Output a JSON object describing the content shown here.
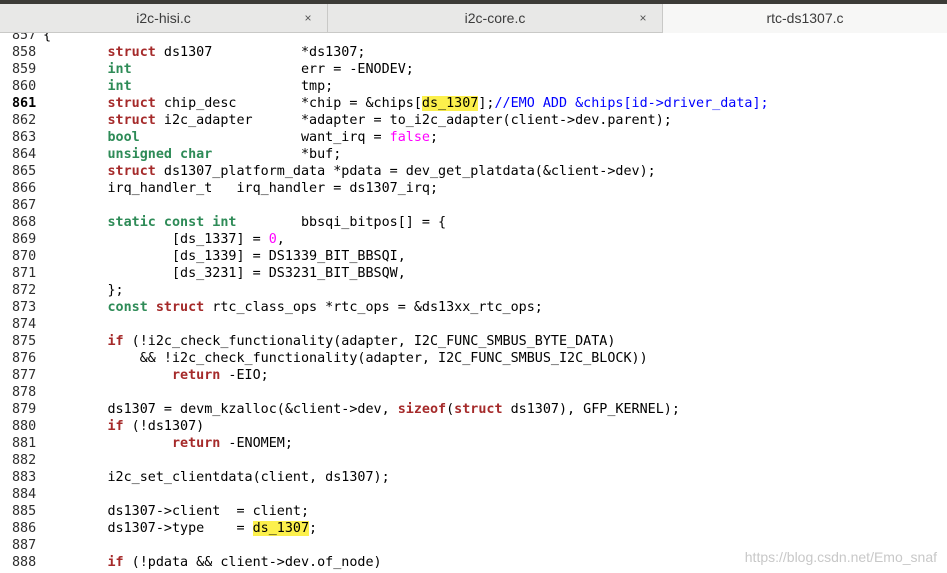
{
  "tabs": [
    {
      "label": "i2c-hisi.c",
      "close": "×"
    },
    {
      "label": "i2c-core.c",
      "close": "×"
    },
    {
      "label": "rtc-ds1307.c",
      "close": ""
    }
  ],
  "active_tab": "rtc-ds1307.c",
  "current_line": "861",
  "highlight_term": "ds_1307",
  "lines": [
    {
      "n": "857",
      "tokens": [
        [
          "t",
          "{"
        ]
      ]
    },
    {
      "n": "858",
      "tokens": [
        [
          "t",
          "        "
        ],
        [
          "kw",
          "struct"
        ],
        [
          "t",
          " ds1307           *ds1307;"
        ]
      ]
    },
    {
      "n": "859",
      "tokens": [
        [
          "t",
          "        "
        ],
        [
          "ty",
          "int"
        ],
        [
          "t",
          "                     err = -ENODEV;"
        ]
      ]
    },
    {
      "n": "860",
      "tokens": [
        [
          "t",
          "        "
        ],
        [
          "ty",
          "int"
        ],
        [
          "t",
          "                     tmp;"
        ]
      ]
    },
    {
      "n": "861",
      "tokens": [
        [
          "t",
          "        "
        ],
        [
          "kw",
          "struct"
        ],
        [
          "t",
          " chip_desc        *chip = &chips["
        ],
        [
          "hl",
          "ds_1307"
        ],
        [
          "t",
          "];"
        ],
        [
          "cm",
          "//EMO ADD &chips[id->driver_data];"
        ]
      ]
    },
    {
      "n": "862",
      "tokens": [
        [
          "t",
          "        "
        ],
        [
          "kw",
          "struct"
        ],
        [
          "t",
          " i2c_adapter      *adapter = to_i2c_adapter(client->dev.parent);"
        ]
      ]
    },
    {
      "n": "863",
      "tokens": [
        [
          "t",
          "        "
        ],
        [
          "ty",
          "bool"
        ],
        [
          "t",
          "                    want_irq = "
        ],
        [
          "num",
          "false"
        ],
        [
          "t",
          ";"
        ]
      ]
    },
    {
      "n": "864",
      "tokens": [
        [
          "t",
          "        "
        ],
        [
          "ty",
          "unsigned char"
        ],
        [
          "t",
          "           *buf;"
        ]
      ]
    },
    {
      "n": "865",
      "tokens": [
        [
          "t",
          "        "
        ],
        [
          "kw",
          "struct"
        ],
        [
          "t",
          " ds1307_platform_data *pdata = dev_get_platdata(&client->dev);"
        ]
      ]
    },
    {
      "n": "866",
      "tokens": [
        [
          "t",
          "        irq_handler_t   irq_handler = ds1307_irq;"
        ]
      ]
    },
    {
      "n": "867",
      "tokens": []
    },
    {
      "n": "868",
      "tokens": [
        [
          "t",
          "        "
        ],
        [
          "ty",
          "static const int"
        ],
        [
          "t",
          "        bbsqi_bitpos[] = {"
        ]
      ]
    },
    {
      "n": "869",
      "tokens": [
        [
          "t",
          "                [ds_1337] = "
        ],
        [
          "num",
          "0"
        ],
        [
          "t",
          ","
        ]
      ]
    },
    {
      "n": "870",
      "tokens": [
        [
          "t",
          "                [ds_1339] = DS1339_BIT_BBSQI,"
        ]
      ]
    },
    {
      "n": "871",
      "tokens": [
        [
          "t",
          "                [ds_3231] = DS3231_BIT_BBSQW,"
        ]
      ]
    },
    {
      "n": "872",
      "tokens": [
        [
          "t",
          "        };"
        ]
      ]
    },
    {
      "n": "873",
      "tokens": [
        [
          "t",
          "        "
        ],
        [
          "ty",
          "const"
        ],
        [
          "t",
          " "
        ],
        [
          "kw",
          "struct"
        ],
        [
          "t",
          " rtc_class_ops *rtc_ops = &ds13xx_rtc_ops;"
        ]
      ]
    },
    {
      "n": "874",
      "tokens": []
    },
    {
      "n": "875",
      "tokens": [
        [
          "t",
          "        "
        ],
        [
          "kw",
          "if"
        ],
        [
          "t",
          " (!i2c_check_functionality(adapter, I2C_FUNC_SMBUS_BYTE_DATA)"
        ]
      ]
    },
    {
      "n": "876",
      "tokens": [
        [
          "t",
          "            && !i2c_check_functionality(adapter, I2C_FUNC_SMBUS_I2C_BLOCK))"
        ]
      ]
    },
    {
      "n": "877",
      "tokens": [
        [
          "t",
          "                "
        ],
        [
          "kw",
          "return"
        ],
        [
          "t",
          " -EIO;"
        ]
      ]
    },
    {
      "n": "878",
      "tokens": []
    },
    {
      "n": "879",
      "tokens": [
        [
          "t",
          "        ds1307 = devm_kzalloc(&client->dev, "
        ],
        [
          "kw",
          "sizeof"
        ],
        [
          "t",
          "("
        ],
        [
          "kw",
          "struct"
        ],
        [
          "t",
          " ds1307), GFP_KERNEL);"
        ]
      ]
    },
    {
      "n": "880",
      "tokens": [
        [
          "t",
          "        "
        ],
        [
          "kw",
          "if"
        ],
        [
          "t",
          " (!ds1307)"
        ]
      ]
    },
    {
      "n": "881",
      "tokens": [
        [
          "t",
          "                "
        ],
        [
          "kw",
          "return"
        ],
        [
          "t",
          " -ENOMEM;"
        ]
      ]
    },
    {
      "n": "882",
      "tokens": []
    },
    {
      "n": "883",
      "tokens": [
        [
          "t",
          "        i2c_set_clientdata(client, ds1307);"
        ]
      ]
    },
    {
      "n": "884",
      "tokens": []
    },
    {
      "n": "885",
      "tokens": [
        [
          "t",
          "        ds1307->client  = client;"
        ]
      ]
    },
    {
      "n": "886",
      "tokens": [
        [
          "t",
          "        ds1307->type    = "
        ],
        [
          "hl",
          "ds_1307"
        ],
        [
          "t",
          ";"
        ]
      ]
    },
    {
      "n": "887",
      "tokens": []
    },
    {
      "n": "888",
      "tokens": [
        [
          "t",
          "        "
        ],
        [
          "kw",
          "if"
        ],
        [
          "t",
          " (!pdata && client->dev.of_node)"
        ]
      ]
    }
  ],
  "watermark": "https://blog.csdn.net/Emo_snaf"
}
